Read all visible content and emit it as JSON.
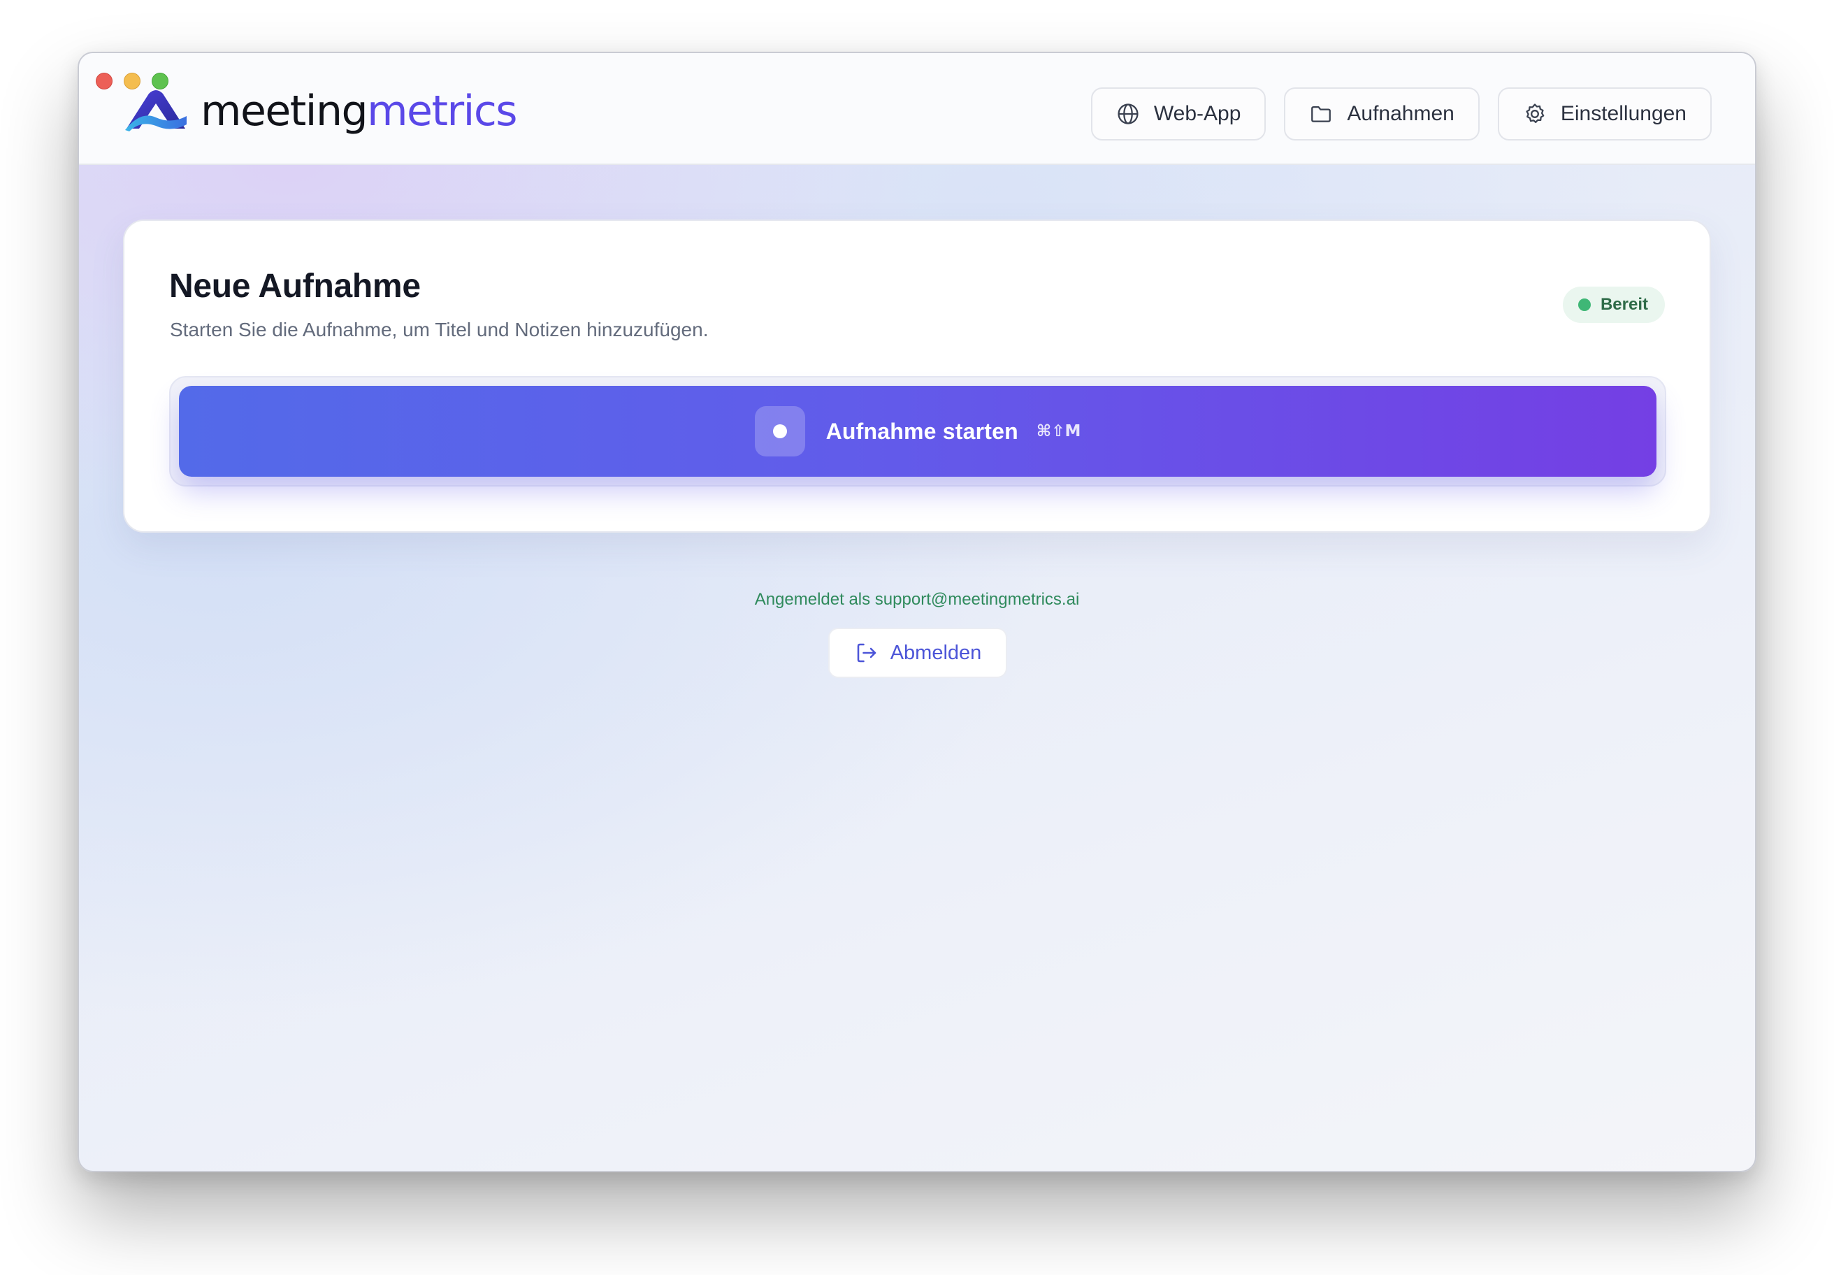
{
  "app": {
    "logo_part1": "meeting",
    "logo_part2": "metrics"
  },
  "nav": {
    "webapp": "Web-App",
    "recordings": "Aufnahmen",
    "settings": "Einstellungen"
  },
  "card": {
    "title": "Neue Aufnahme",
    "subtitle": "Starten Sie die Aufnahme, um Titel und Notizen hinzuzufügen.",
    "status": "Bereit",
    "record_label": "Aufnahme starten",
    "shortcut": "⌘⇧M"
  },
  "account": {
    "login_info": "Angemeldet als support@meetingmetrics.ai",
    "logout_label": "Abmelden"
  },
  "icons": {
    "webapp": "globe-icon",
    "recordings": "folder-icon",
    "settings": "gear-icon",
    "logout": "logout-icon",
    "record": "record-dot-icon"
  },
  "colors": {
    "accent_start": "#536ae9",
    "accent_end": "#743fe4",
    "status_green": "#3fb776",
    "brand_purple": "#5a48e8"
  }
}
